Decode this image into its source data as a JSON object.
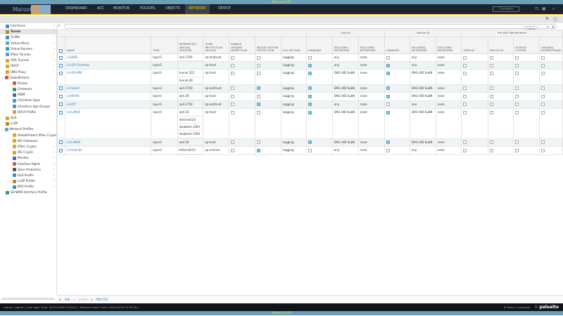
{
  "banner": "MaroxLan-FW",
  "nav": {
    "logo": "MaroxLan",
    "tabs": [
      "DASHBOARD",
      "ACC",
      "MONITOR",
      "POLICIES",
      "OBJECTS",
      "NETWORK",
      "DEVICE"
    ],
    "active": "NETWORK",
    "commit": "Commit"
  },
  "sidebar": [
    {
      "label": "Interfaces",
      "level": 0,
      "color": "#3a8fc8"
    },
    {
      "label": "Zones",
      "level": 0,
      "color": "#b08a30",
      "selected": true
    },
    {
      "label": "VLANs",
      "level": 0,
      "color": "#3a8fc8"
    },
    {
      "label": "Virtual Wires",
      "level": 0,
      "color": "#6aa0c8"
    },
    {
      "label": "Virtual Routers",
      "level": 0,
      "color": "#3a8fc8"
    },
    {
      "label": "IPSec Tunnels",
      "level": 0,
      "color": "#5a9ad0"
    },
    {
      "label": "GRE Tunnels",
      "level": 0,
      "color": "#e0a020"
    },
    {
      "label": "DHCP",
      "level": 0,
      "color": "#e0a020"
    },
    {
      "label": "DNS Proxy",
      "level": 0,
      "color": "#e0a020"
    },
    {
      "label": "GlobalProtect",
      "level": 0,
      "color": "#d05a3a",
      "group": true
    },
    {
      "label": "Portals",
      "level": 1,
      "color": "#d05a3a"
    },
    {
      "label": "Gateways",
      "level": 1,
      "color": "#3a9a5a"
    },
    {
      "label": "MDM",
      "level": 1,
      "color": "#3a6ac8"
    },
    {
      "label": "Clientless Apps",
      "level": 1,
      "color": "#3a9ac8"
    },
    {
      "label": "Clientless App Groups",
      "level": 1,
      "color": "#3a9ac8"
    },
    {
      "label": "DHCP Profile",
      "level": 1,
      "color": "#e0a020"
    },
    {
      "label": "QoS",
      "level": 0,
      "color": "#e0a020"
    },
    {
      "label": "LLDP",
      "level": 0,
      "color": "#b08a30"
    },
    {
      "label": "Network Profiles",
      "level": 0,
      "color": "#6aa0c8",
      "group": true
    },
    {
      "label": "GlobalProtect IPSec Crypto",
      "level": 1,
      "color": "#e0a020"
    },
    {
      "label": "IKE Gateways",
      "level": 1,
      "color": "#e0a020"
    },
    {
      "label": "IPSec Crypto",
      "level": 1,
      "color": "#e0a020"
    },
    {
      "label": "IKE Crypto",
      "level": 1,
      "color": "#e0a020"
    },
    {
      "label": "Monitor",
      "level": 1,
      "color": "#3a6ac8"
    },
    {
      "label": "Interface Mgmt",
      "level": 1,
      "color": "#d05a3a"
    },
    {
      "label": "Zone Protection",
      "level": 1,
      "color": "#555"
    },
    {
      "label": "QoS Profile",
      "level": 1,
      "color": "#3a8fc8"
    },
    {
      "label": "LLDP Profile",
      "level": 1,
      "color": "#b08a30"
    },
    {
      "label": "BFD Profile",
      "level": 1,
      "color": "#3a8fc8"
    },
    {
      "label": "SD-WAN Interface Profile",
      "level": 0,
      "color": "#3a9a5a"
    }
  ],
  "search": {
    "placeholder": "",
    "count": "9 items"
  },
  "table": {
    "groups": [
      "User-ID",
      "Device-ID",
      "Pre-NAT Identification"
    ],
    "columns": [
      "NAME",
      "TYPE",
      "INTERFACES / VIRTUAL SYSTEMS",
      "ZONE PROTECTION PROFILE",
      "ENABLE HEADER INSPECTION",
      "PACKET BUFFER PROTECTION",
      "LOG SETTING",
      "ENABLED",
      "INCLUDED NETWORKS",
      "EXCLUDED NETWORKS",
      "ENABLED",
      "INCLUDED NETWORKS",
      "EXCLUDED NETWORKS",
      "USER-ID",
      "DEVICE-ID",
      "SOURCE LOOKUP",
      "ORIGINAL DOWNSTREAM"
    ],
    "rows": [
      {
        "name": "L3-DMZ",
        "type": "layer3",
        "ifaces": [
          "ae4.1760"
        ],
        "zpp": "zp-midtrust",
        "hdr": false,
        "pbp": false,
        "log": "Logging",
        "uid": false,
        "uinc": "any",
        "uexc": "none",
        "did": false,
        "dinc": "any",
        "dexc": "none"
      },
      {
        "name": "L3-GP-Clientless",
        "type": "layer3",
        "ifaces": [],
        "zpp": "zp-trust",
        "hdr": false,
        "pbp": false,
        "log": "Logging",
        "uid": true,
        "uinc": "any",
        "uexc": "none",
        "did": true,
        "dinc": "any",
        "dexc": "none"
      },
      {
        "name": "L3-GP-VPN",
        "type": "layer3",
        "ifaces": [
          "tunnel.222",
          "tunnel.40"
        ],
        "zpp": "zp-trust",
        "hdr": false,
        "pbp": false,
        "log": "Logging",
        "uid": true,
        "uinc": "DAG-UID-SubN",
        "uexc": "none",
        "did": true,
        "dinc": "DAG-UID-SubN",
        "dexc": "none"
      },
      {
        "name": "L3-Guest",
        "type": "layer3",
        "ifaces": [
          "ae4.1740"
        ],
        "zpp": "zp-midtrust",
        "hdr": false,
        "pbp": true,
        "log": "Logging",
        "uid": true,
        "uinc": "DAG-UID-SubN",
        "uexc": "none",
        "did": true,
        "dinc": "DAG-UID-SubN",
        "dexc": "none"
      },
      {
        "name": "L3-INFRA",
        "type": "layer3",
        "ifaces": [
          "ae4.30"
        ],
        "zpp": "zp-trust",
        "hdr": false,
        "pbp": false,
        "log": "Logging",
        "uid": true,
        "uinc": "DAG-UID-SubN",
        "uexc": "none",
        "did": true,
        "dinc": "DAG-UID-SubN",
        "dexc": "none"
      },
      {
        "name": "L3-IOT",
        "type": "layer3",
        "ifaces": [
          "ae4.1750"
        ],
        "zpp": "zp-midtrust",
        "hdr": false,
        "pbp": true,
        "log": "Logging",
        "uid": true,
        "uinc": "any",
        "uexc": "none",
        "did": false,
        "dinc": "any",
        "dexc": "none"
      },
      {
        "name": "L3-LAN10",
        "type": "layer3",
        "ifaces": [
          "ae4.10",
          "ethernet1/4",
          "loopback.1003",
          "loopback.1004"
        ],
        "zpp": "zp-trust",
        "hdr": false,
        "pbp": false,
        "log": "Logging",
        "uid": true,
        "uinc": "DAG-UID-SubN",
        "uexc": "none",
        "did": true,
        "dinc": "DAG-UID-SubN",
        "dexc": "none"
      },
      {
        "name": "L3-LAN20",
        "type": "layer3",
        "ifaces": [
          "ae4.20"
        ],
        "zpp": "zp-trust",
        "hdr": false,
        "pbp": false,
        "log": "Logging",
        "uid": true,
        "uinc": "DAG-UID-SubN",
        "uexc": "none",
        "did": true,
        "dinc": "DAG-UID-SubN",
        "dexc": "none"
      },
      {
        "name": "L3-Outside",
        "type": "layer3",
        "ifaces": [
          "ethernet1/1"
        ],
        "zpp": "zp-untrust",
        "hdr": false,
        "pbp": true,
        "log": "Logging",
        "uid": false,
        "uinc": "any",
        "uexc": "none",
        "did": false,
        "dinc": "any",
        "dexc": "none"
      }
    ]
  },
  "actions": {
    "add": "Add",
    "delete": "Delete",
    "pdf": "PDF/CSV"
  },
  "footer": {
    "user": "marox",
    "logout": "Logout",
    "last_login": "Last Login Time: 04/01/2026 23:44:47",
    "session": "Session Expire Time: 05/01/2026 23:34:28",
    "tasks": "Tasks",
    "language": "Language",
    "brand": "paloalto"
  },
  "colors": {
    "nav_bg": "#1b2230",
    "accent": "#f5c400",
    "banner": "#6aa0b8",
    "link": "#2a7ab8"
  }
}
